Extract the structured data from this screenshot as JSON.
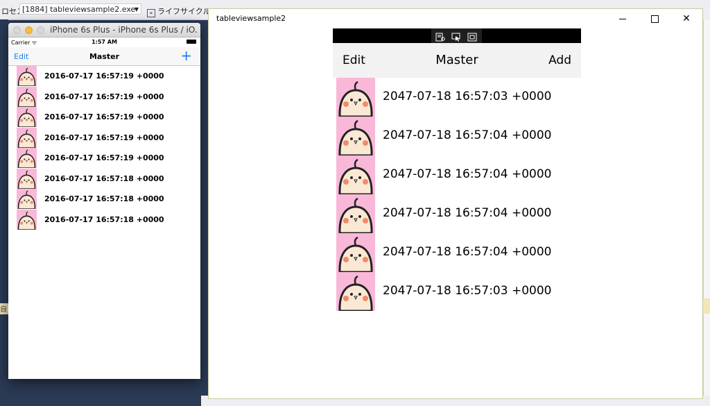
{
  "vs": {
    "process_label": "ロセス",
    "process_value": "[1884] tableviewsample2.exe",
    "lifecycle_label": "ライフサイクル イ",
    "status_left": "自"
  },
  "simulator": {
    "window_title": "iPhone 6s Plus - iPhone 6s Plus / iO...",
    "carrier": "Carrier",
    "time": "1:57 AM",
    "nav_edit": "Edit",
    "nav_title": "Master",
    "nav_add": "+",
    "rows": [
      "2016-07-17 16:57:19 +0000",
      "2016-07-17 16:57:19 +0000",
      "2016-07-17 16:57:19 +0000",
      "2016-07-17 16:57:19 +0000",
      "2016-07-17 16:57:19 +0000",
      "2016-07-17 16:57:18 +0000",
      "2016-07-17 16:57:18 +0000",
      "2016-07-17 16:57:18 +0000"
    ]
  },
  "uwp": {
    "window_title": "tableviewsample2",
    "edit": "Edit",
    "title": "Master",
    "add": "Add",
    "rows": [
      "2047-07-18 16:57:03 +0000",
      "2047-07-18 16:57:04 +0000",
      "2047-07-18 16:57:04 +0000",
      "2047-07-18 16:57:04 +0000",
      "2047-07-18 16:57:04 +0000",
      "2047-07-18 16:57:03 +0000"
    ]
  },
  "colors": {
    "ios_tint": "#1a7cf5",
    "thumb_bg": "#f9b8d8",
    "face": "#fbe8d4"
  },
  "icons": {
    "thumbnail": "chick-avatar-icon",
    "debug_toolbar": [
      "live-visual-tree-icon",
      "select-element-icon",
      "layout-adorner-icon"
    ]
  }
}
